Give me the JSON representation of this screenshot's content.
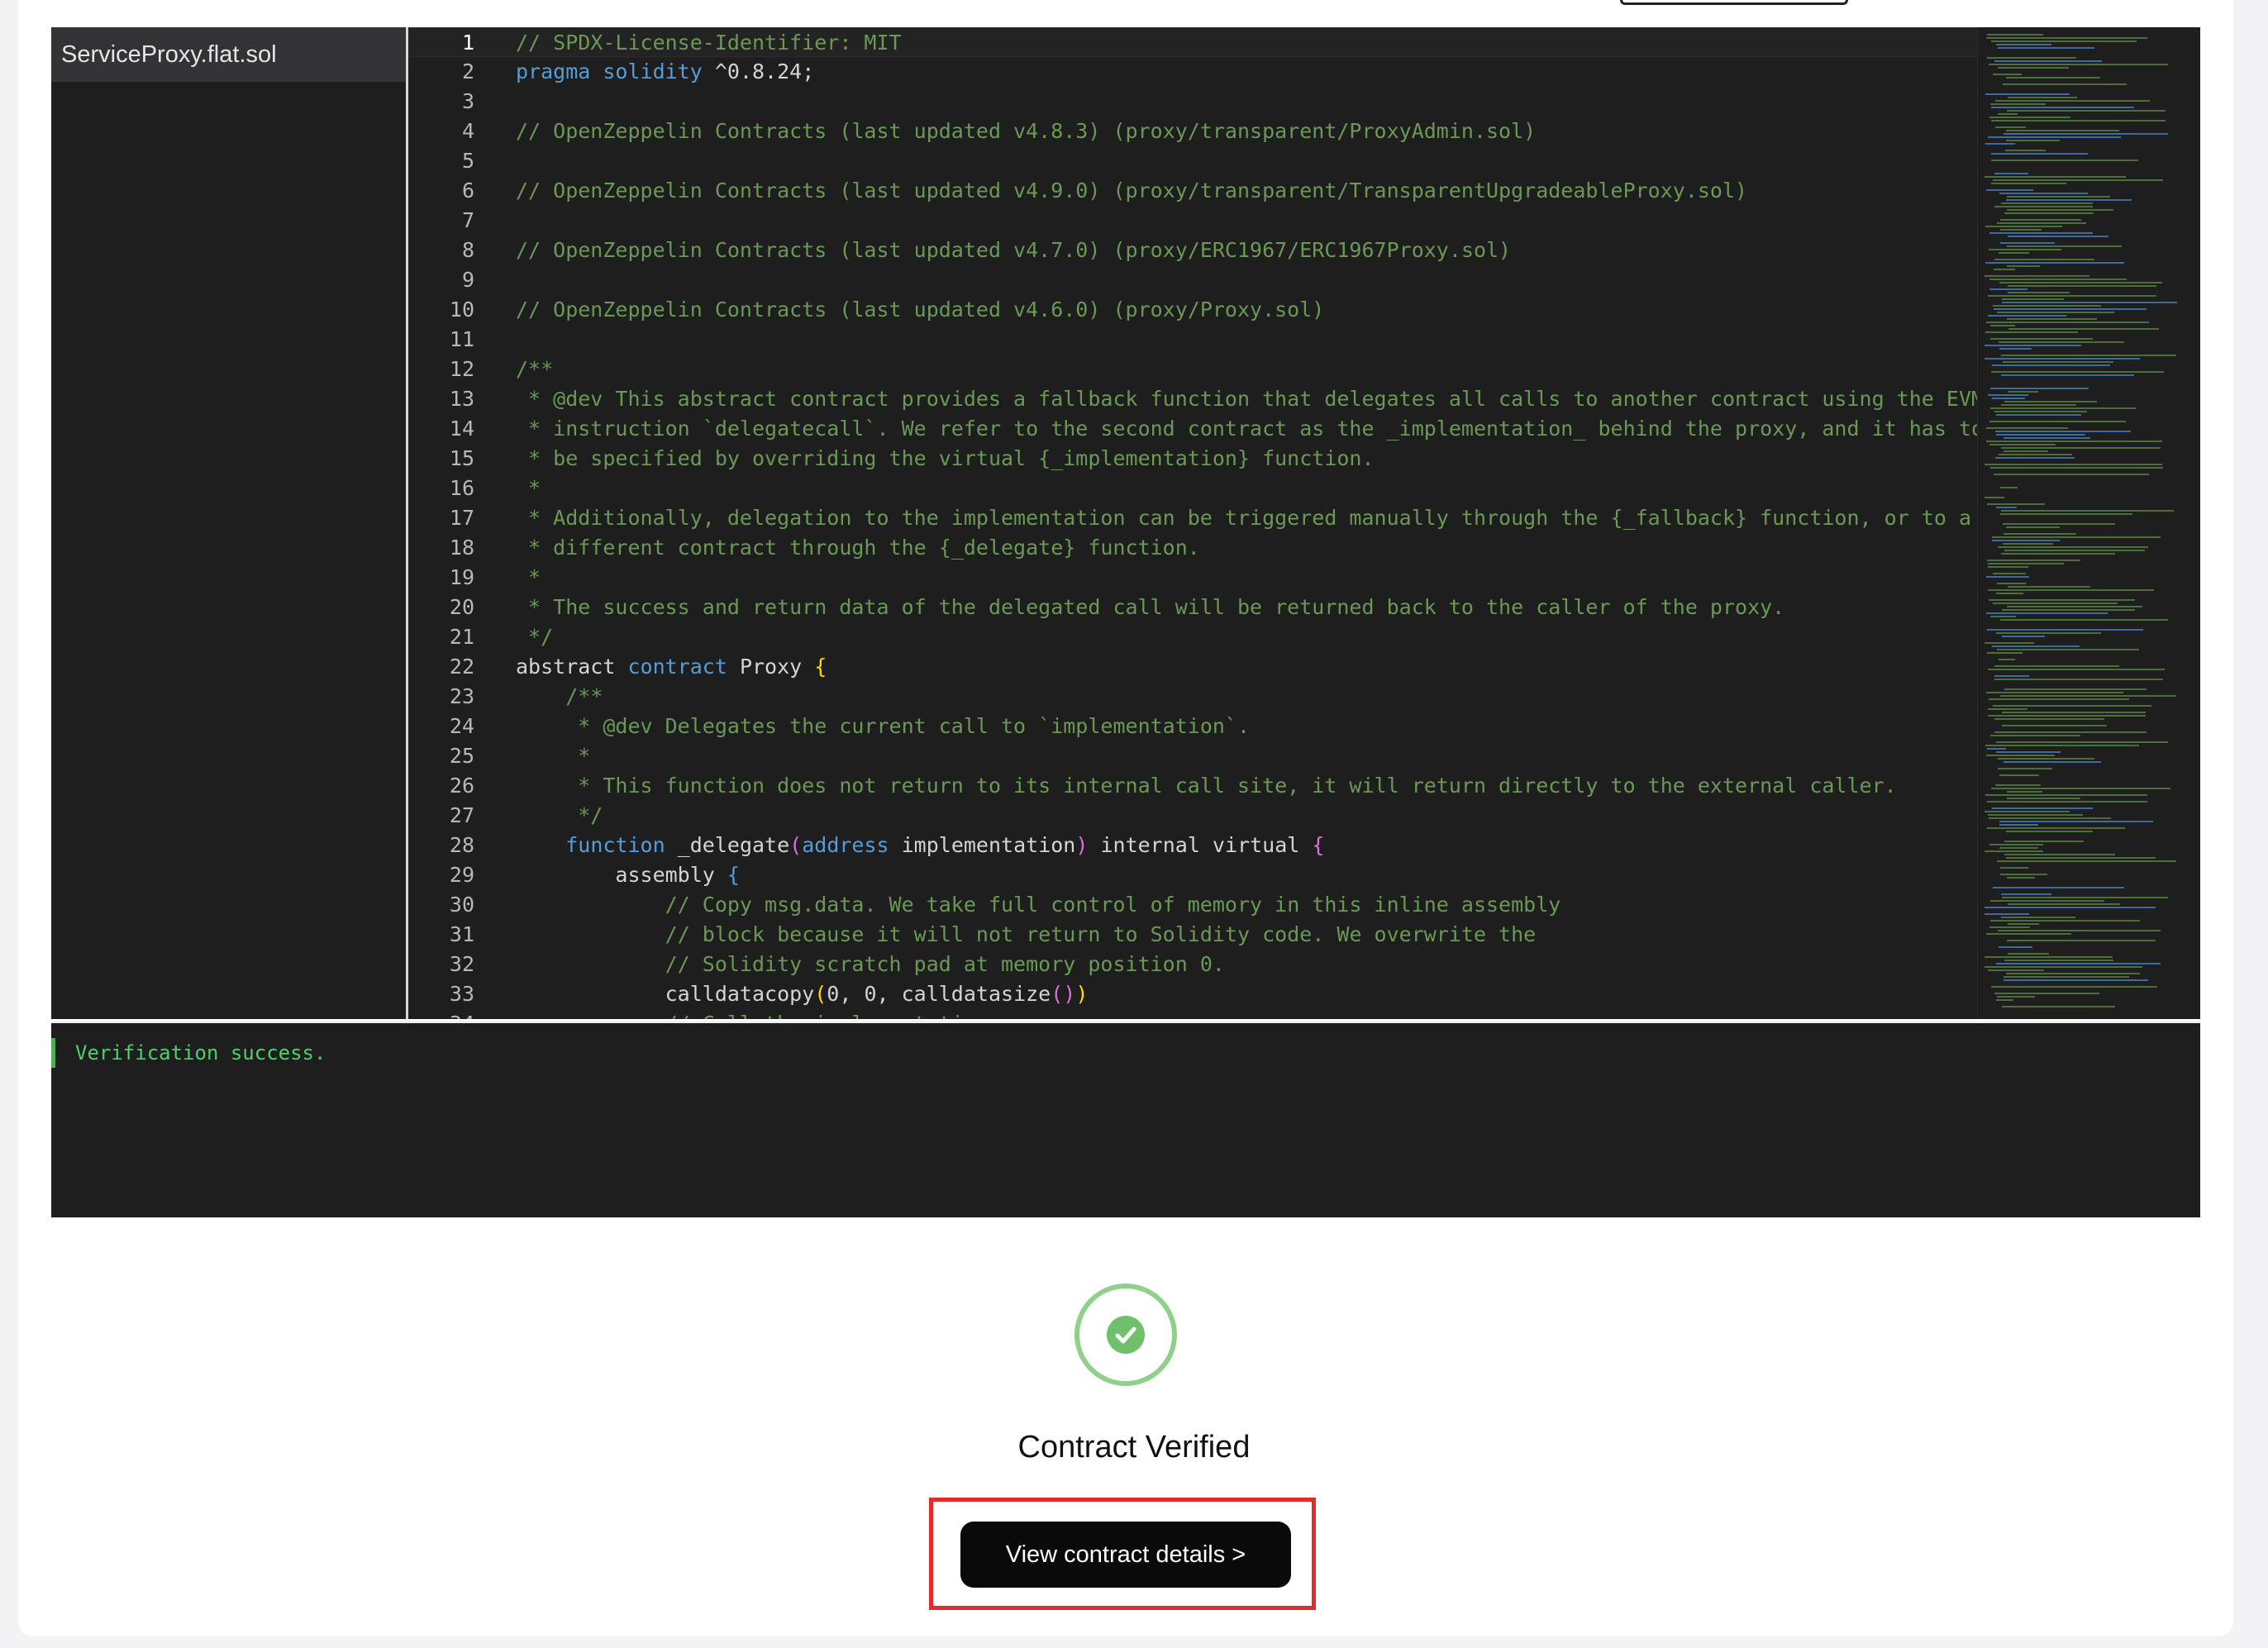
{
  "file_tree": {
    "selected_file": "ServiceProxy.flat.sol"
  },
  "code": {
    "lines": [
      [
        {
          "t": "// SPDX-License-Identifier: MIT",
          "c": "c"
        }
      ],
      [
        {
          "t": "pragma",
          "c": "k"
        },
        {
          "t": " "
        },
        {
          "t": "solidity",
          "c": "k"
        },
        {
          "t": " ^0.8.24;"
        }
      ],
      [],
      [
        {
          "t": "// OpenZeppelin Contracts (last updated v4.8.3) (proxy/transparent/ProxyAdmin.sol)",
          "c": "c"
        }
      ],
      [],
      [
        {
          "t": "// OpenZeppelin Contracts (last updated v4.9.0) (proxy/transparent/TransparentUpgradeableProxy.sol)",
          "c": "c"
        }
      ],
      [],
      [
        {
          "t": "// OpenZeppelin Contracts (last updated v4.7.0) (proxy/ERC1967/ERC1967Proxy.sol)",
          "c": "c"
        }
      ],
      [],
      [
        {
          "t": "// OpenZeppelin Contracts (last updated v4.6.0) (proxy/Proxy.sol)",
          "c": "c"
        }
      ],
      [],
      [
        {
          "t": "/**",
          "c": "c"
        }
      ],
      [
        {
          "t": " * @dev This abstract contract provides a fallback function that delegates all calls to another contract using the EVM",
          "c": "c"
        }
      ],
      [
        {
          "t": " * instruction `delegatecall`. We refer to the second contract as the _implementation_ behind the proxy, and it has to",
          "c": "c"
        }
      ],
      [
        {
          "t": " * be specified by overriding the virtual {_implementation} function.",
          "c": "c"
        }
      ],
      [
        {
          "t": " *",
          "c": "c"
        }
      ],
      [
        {
          "t": " * Additionally, delegation to the implementation can be triggered manually through the {_fallback} function, or to a",
          "c": "c"
        }
      ],
      [
        {
          "t": " * different contract through the {_delegate} function.",
          "c": "c"
        }
      ],
      [
        {
          "t": " *",
          "c": "c"
        }
      ],
      [
        {
          "t": " * The success and return data of the delegated call will be returned back to the caller of the proxy.",
          "c": "c"
        }
      ],
      [
        {
          "t": " */",
          "c": "c"
        }
      ],
      [
        {
          "t": "abstract "
        },
        {
          "t": "contract",
          "c": "k"
        },
        {
          "t": " Proxy "
        },
        {
          "t": "{",
          "c": "p"
        }
      ],
      [
        {
          "t": "    "
        },
        {
          "t": "/**",
          "c": "c"
        }
      ],
      [
        {
          "t": "     * @dev Delegates the current call to `implementation`.",
          "c": "c"
        }
      ],
      [
        {
          "t": "     *",
          "c": "c"
        }
      ],
      [
        {
          "t": "     * This function does not return to its internal call site, it will return directly to the external caller.",
          "c": "c"
        }
      ],
      [
        {
          "t": "     */",
          "c": "c"
        }
      ],
      [
        {
          "t": "    "
        },
        {
          "t": "function",
          "c": "k"
        },
        {
          "t": " _delegate"
        },
        {
          "t": "(",
          "c": "m"
        },
        {
          "t": "address",
          "c": "k"
        },
        {
          "t": " implementation"
        },
        {
          "t": ")",
          "c": "m"
        },
        {
          "t": " internal virtual "
        },
        {
          "t": "{",
          "c": "m"
        }
      ],
      [
        {
          "t": "        assembly "
        },
        {
          "t": "{",
          "c": "k"
        }
      ],
      [
        {
          "t": "            "
        },
        {
          "t": "// Copy msg.data. We take full control of memory in this inline assembly",
          "c": "c"
        }
      ],
      [
        {
          "t": "            "
        },
        {
          "t": "// block because it will not return to Solidity code. We overwrite the",
          "c": "c"
        }
      ],
      [
        {
          "t": "            "
        },
        {
          "t": "// Solidity scratch pad at memory position 0.",
          "c": "c"
        }
      ],
      [
        {
          "t": "            calldatacopy"
        },
        {
          "t": "(",
          "c": "p"
        },
        {
          "t": "0, 0, calldatasize"
        },
        {
          "t": "()",
          "c": "m"
        },
        {
          "t": ")",
          "c": "p"
        }
      ],
      [
        {
          "t": "            "
        },
        {
          "t": "// Call the implementation.",
          "c": "c"
        }
      ]
    ]
  },
  "console": {
    "message": "Verification success."
  },
  "result": {
    "title": "Contract Verified",
    "button_label": "View contract details >"
  },
  "colors": {
    "success_green": "#4fd06a",
    "check_green": "#6fc06a",
    "highlight_red": "#e32b2b",
    "button_black": "#0a0a0a"
  }
}
